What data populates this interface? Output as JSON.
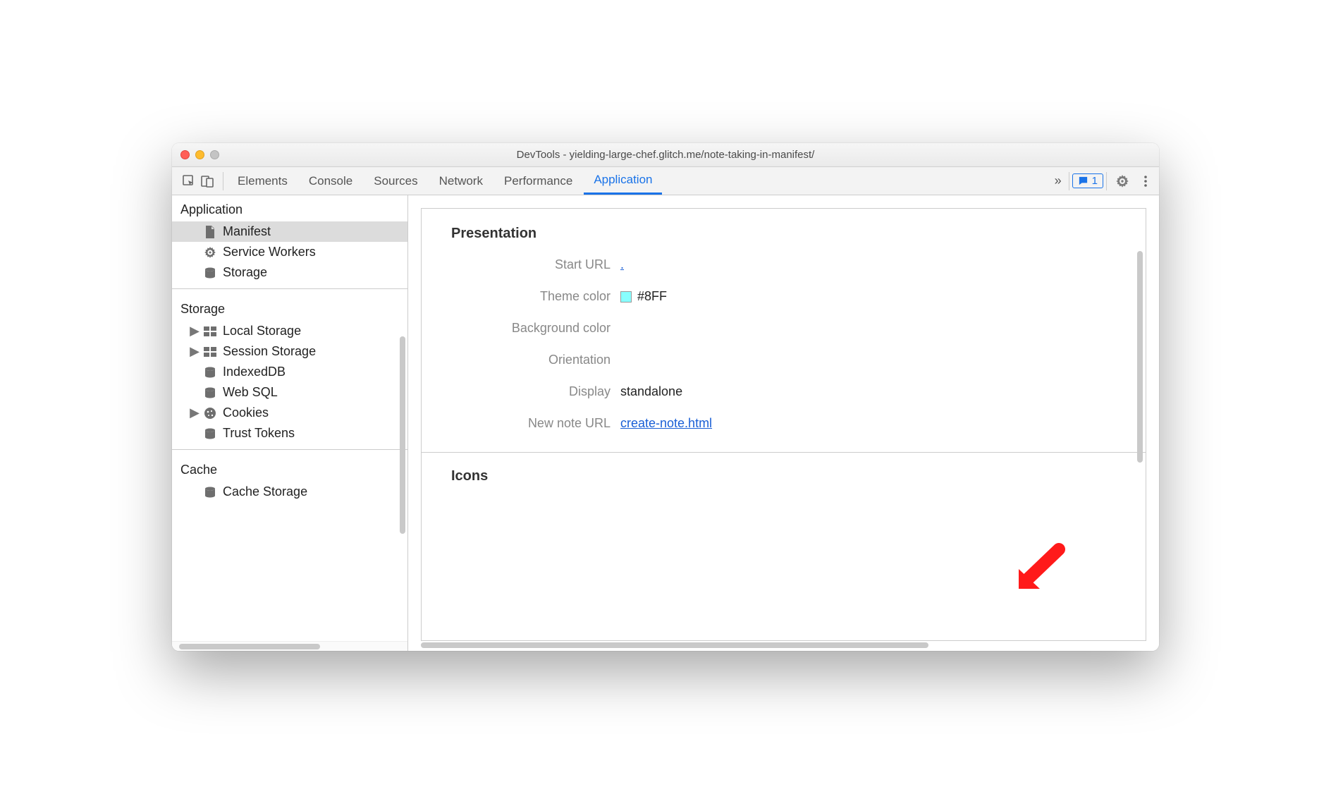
{
  "window": {
    "title": "DevTools - yielding-large-chef.glitch.me/note-taking-in-manifest/"
  },
  "toolbar": {
    "tabs": [
      "Elements",
      "Console",
      "Sources",
      "Network",
      "Performance",
      "Application"
    ],
    "active_tab_index": 5,
    "issues_count": "1"
  },
  "sidebar": {
    "sections": [
      {
        "title": "Application",
        "items": [
          {
            "icon": "file-icon",
            "label": "Manifest",
            "selected": true
          },
          {
            "icon": "gear-icon",
            "label": "Service Workers"
          },
          {
            "icon": "database-icon",
            "label": "Storage"
          }
        ]
      },
      {
        "title": "Storage",
        "items": [
          {
            "icon": "table-icon",
            "label": "Local Storage",
            "expandable": true
          },
          {
            "icon": "table-icon",
            "label": "Session Storage",
            "expandable": true
          },
          {
            "icon": "database-icon",
            "label": "IndexedDB"
          },
          {
            "icon": "database-icon",
            "label": "Web SQL"
          },
          {
            "icon": "cookie-icon",
            "label": "Cookies",
            "expandable": true
          },
          {
            "icon": "database-icon",
            "label": "Trust Tokens"
          }
        ]
      },
      {
        "title": "Cache",
        "items": [
          {
            "icon": "database-icon",
            "label": "Cache Storage"
          }
        ]
      }
    ]
  },
  "main": {
    "presentation_heading": "Presentation",
    "fields": {
      "start_url_label": "Start URL",
      "start_url_value": ".",
      "theme_color_label": "Theme color",
      "theme_color_value": "#8FF",
      "background_color_label": "Background color",
      "background_color_value": "",
      "orientation_label": "Orientation",
      "orientation_value": "",
      "display_label": "Display",
      "display_value": "standalone",
      "new_note_url_label": "New note URL",
      "new_note_url_value": "create-note.html"
    },
    "icons_heading": "Icons"
  }
}
